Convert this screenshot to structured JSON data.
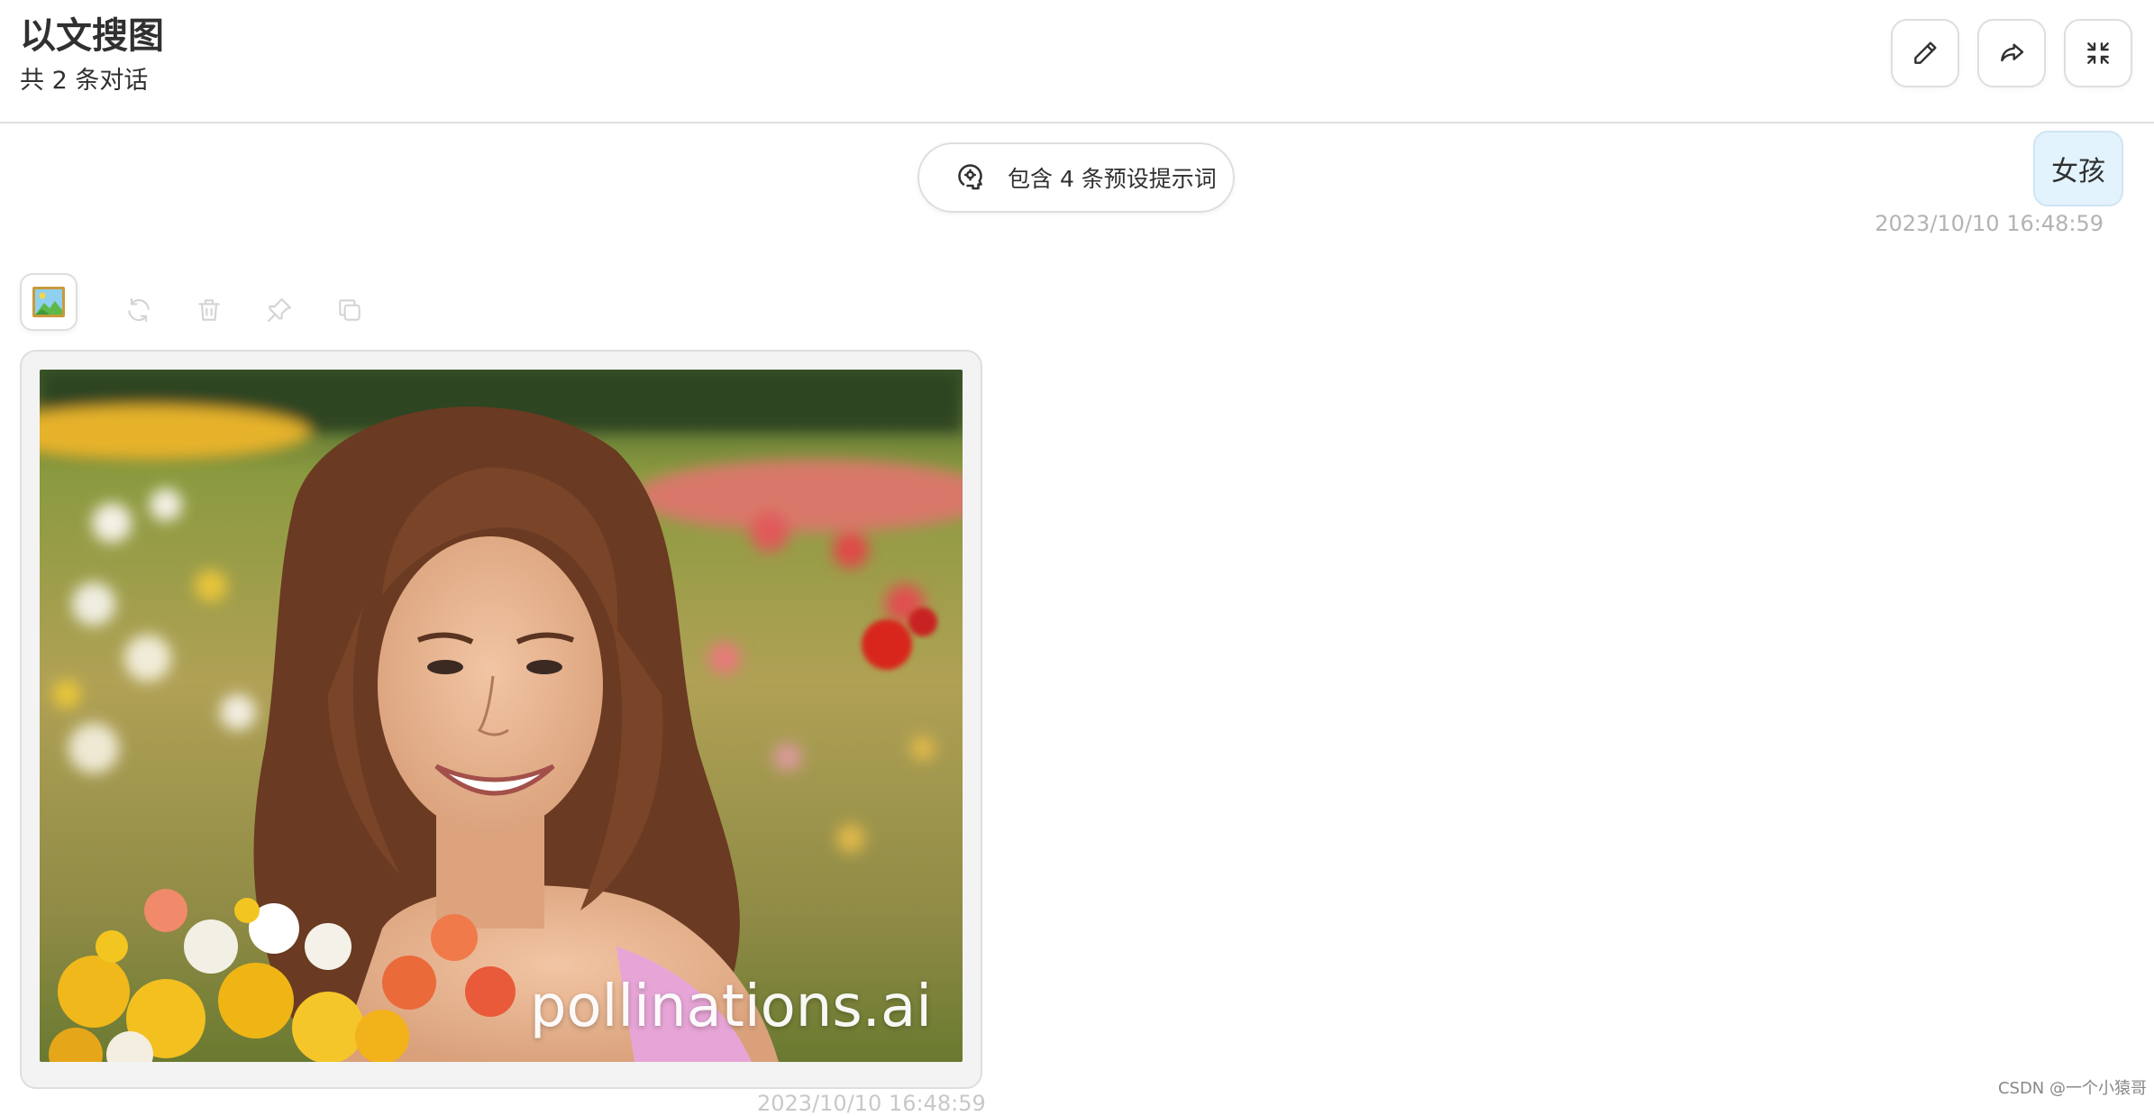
{
  "header": {
    "title": "以文搜图",
    "subtitle": "共 2 条对话",
    "buttons": [
      {
        "name": "edit",
        "icon": "pencil-icon"
      },
      {
        "name": "share",
        "icon": "share-icon"
      },
      {
        "name": "minimize",
        "icon": "collapse-icon"
      }
    ]
  },
  "prompts": {
    "label": "包含 4 条预设提示词",
    "icon": "brain-icon"
  },
  "user_message": {
    "text": "女孩",
    "time": "2023/10/10 16:48:59"
  },
  "bot_message": {
    "avatar": "picture-icon",
    "actions": [
      "refresh-icon",
      "delete-icon",
      "pin-icon",
      "copy-icon"
    ],
    "image_watermark": "pollinations.ai",
    "time": "2023/10/10 16:48:59"
  },
  "page_watermark": "CSDN @一个小猿哥"
}
